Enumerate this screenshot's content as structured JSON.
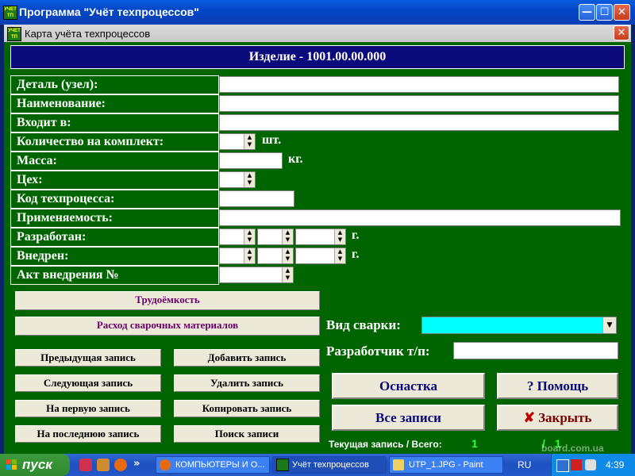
{
  "window": {
    "title": "Программа \"Учёт техпроцессов\"",
    "icon_text": "УЧЁТ ТП",
    "minimize": "—",
    "maximize": "☐",
    "close": "✕"
  },
  "child_window": {
    "title": "Карта учёта техпроцессов",
    "close": "✕"
  },
  "header": {
    "title": "Изделие - 1001.00.00.000"
  },
  "form": {
    "detail_label": "Деталь (узел):",
    "name_label": "Наименование:",
    "included_label": "Входит в:",
    "qty_label": "Количество на комплект:",
    "qty_unit": "шт.",
    "mass_label": "Масса:",
    "mass_unit": "кг.",
    "shop_label": "Цех:",
    "process_code_label": "Код техпроцесса:",
    "applicability_label": "Применяемость:",
    "developed_label": "Разработан:",
    "developed_unit": "г.",
    "implemented_label": "Внедрен:",
    "implemented_unit": "г.",
    "act_label": "Акт внедрения №"
  },
  "buttons": {
    "labor": "Трудоёмкость",
    "welding_materials": "Расход сварочных материалов",
    "prev": "Предыдущая запись",
    "next": "Следующая запись",
    "first": "На первую запись",
    "last": "На последнюю запись",
    "add": "Добавить запись",
    "delete": "Удалить запись",
    "copy": "Копировать запись",
    "search": "Поиск записи",
    "tooling": "Оснастка",
    "all_records": "Все записи",
    "help": "Помощь",
    "help_icon": "?",
    "close": "Закрыть",
    "close_icon": "✘"
  },
  "side": {
    "weld_type_label": "Вид сварки:",
    "weld_type_value": "",
    "developer_label": "Разработчик т/п:"
  },
  "status": {
    "label": "Текущая запись / Всего:",
    "current": "1",
    "separator": "/",
    "total": "1"
  },
  "colors": {
    "card_bg": "#006400",
    "header_bg": "#0a0a7a",
    "weld_combo_bg": "#00ffff",
    "green_number": "#33ff33"
  },
  "taskbar": {
    "start": "пуск",
    "quick_icons": [
      "heart-icon",
      "hand-icon",
      "firefox-icon"
    ],
    "chevron": "»",
    "tasks": [
      {
        "label": "КОМПЬЮТЕРЫ И О...",
        "icon": "firefox-icon",
        "active": false
      },
      {
        "label": "Учёт техпроцессов",
        "icon": "app-icon",
        "active": true
      },
      {
        "label": "UTP_1.JPG - Paint",
        "icon": "paint-icon",
        "active": false
      }
    ],
    "language": "RU",
    "clock": "4:39",
    "watermark": "board.com.ua"
  }
}
